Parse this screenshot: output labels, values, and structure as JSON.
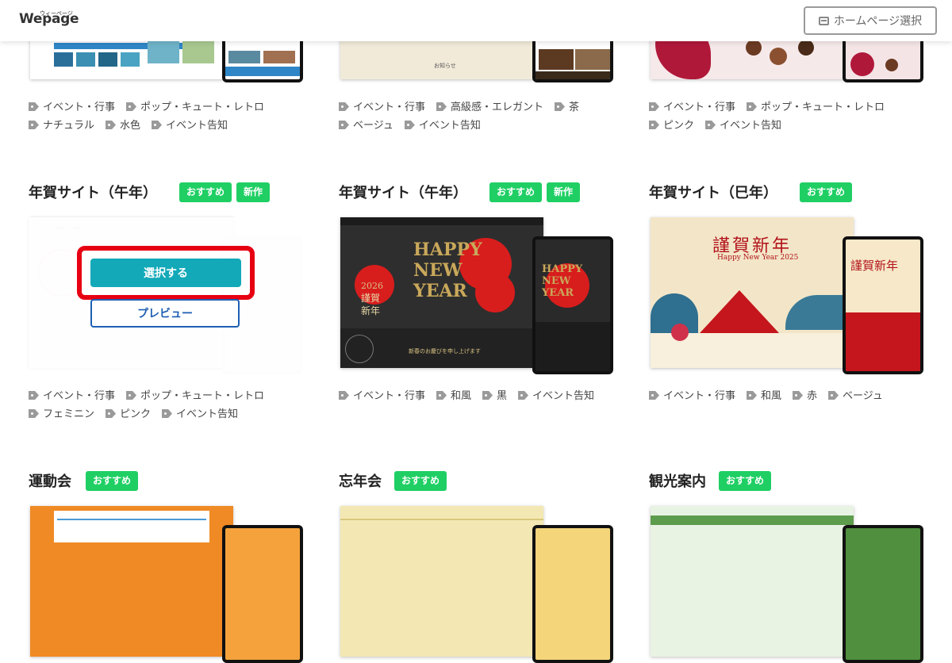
{
  "header": {
    "logo": "Wepage",
    "logo_ruby": "ウィーページ",
    "homepage_select": "ホームページ選択"
  },
  "row1": [
    {
      "tags": [
        "イベント・行事",
        "ポップ・キュート・レトロ",
        "ナチュラル",
        "水色",
        "イベント告知"
      ]
    },
    {
      "tags": [
        "イベント・行事",
        "高級感・エレガント",
        "茶",
        "ベージュ",
        "イベント告知"
      ],
      "thumb_text": "お知らせ"
    },
    {
      "tags": [
        "イベント・行事",
        "ポップ・キュート・レトロ",
        "ピンク",
        "イベント告知"
      ]
    }
  ],
  "row2": [
    {
      "title": "年賀サイト（午年）",
      "badges": [
        "おすすめ",
        "新作"
      ],
      "select_label": "選択する",
      "preview_label": "プレビュー",
      "tags": [
        "イベント・行事",
        "ポップ・キュート・レトロ",
        "フェミニン",
        "ピンク",
        "イベント告知"
      ]
    },
    {
      "title": "年賀サイト（午年）",
      "badges": [
        "おすすめ",
        "新作"
      ],
      "tags": [
        "イベント・行事",
        "和風",
        "黒",
        "イベント告知"
      ],
      "thumb": {
        "year": "2026",
        "greeting": "謹賀\n新年",
        "sub": "新春のお慶びを申し上げます",
        "happy": "HAPPY NEW YEAR"
      }
    },
    {
      "title": "年賀サイト（巳年）",
      "badges": [
        "おすすめ"
      ],
      "tags": [
        "イベント・行事",
        "和風",
        "赤",
        "ベージュ"
      ],
      "thumb": {
        "greeting": "謹賀新年",
        "sub": "Happy New Year 2025"
      }
    }
  ],
  "row3": [
    {
      "title": "運動会",
      "badges": [
        "おすすめ"
      ]
    },
    {
      "title": "忘年会",
      "badges": [
        "おすすめ"
      ]
    },
    {
      "title": "観光案内",
      "badges": [
        "おすすめ"
      ]
    }
  ],
  "colors": {
    "badge": "#1fcf64",
    "select": "#13a9b8",
    "highlight": "#e60012",
    "preview": "#1e5fb4"
  }
}
